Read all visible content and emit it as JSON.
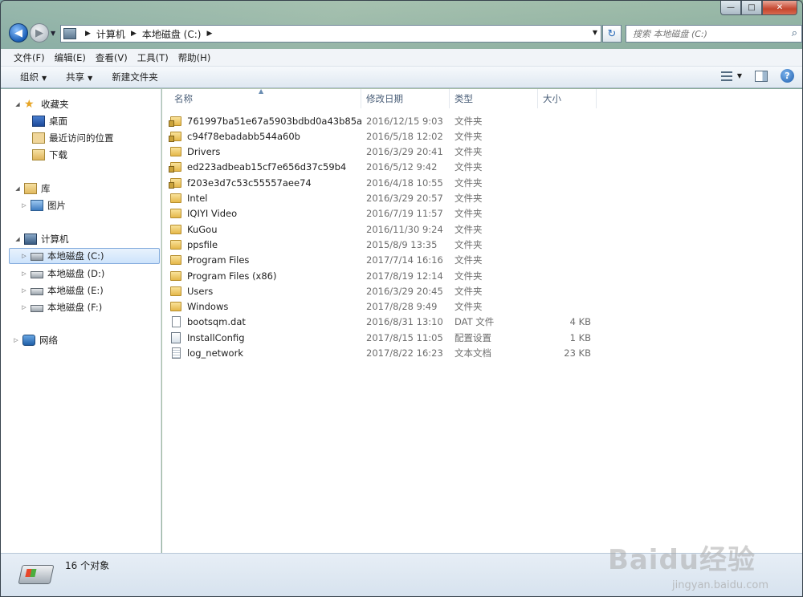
{
  "window": {
    "caption_min": "—",
    "caption_max": "□",
    "caption_close": "✕"
  },
  "address": {
    "crumbs": [
      "计算机",
      "本地磁盘 (C:)"
    ],
    "sep": "▶",
    "search_placeholder": "搜索 本地磁盘 (C:)"
  },
  "menu": [
    "文件(F)",
    "编辑(E)",
    "查看(V)",
    "工具(T)",
    "帮助(H)"
  ],
  "toolbar": {
    "organize": "组织",
    "share": "共享",
    "new_folder": "新建文件夹"
  },
  "nav": {
    "favorites": "收藏夹",
    "desktop": "桌面",
    "recent": "最近访问的位置",
    "downloads": "下载",
    "libraries": "库",
    "pictures": "图片",
    "computer": "计算机",
    "drives": [
      "本地磁盘 (C:)",
      "本地磁盘 (D:)",
      "本地磁盘 (E:)",
      "本地磁盘 (F:)"
    ],
    "network": "网络"
  },
  "columns": {
    "name": "名称",
    "date": "修改日期",
    "type": "类型",
    "size": "大小"
  },
  "files": [
    {
      "name": "761997ba51e67a5903bdbd0a43b85a",
      "date": "2016/12/15 9:03",
      "type": "文件夹",
      "size": "",
      "icon": "folder-locked"
    },
    {
      "name": "c94f78ebadabb544a60b",
      "date": "2016/5/18 12:02",
      "type": "文件夹",
      "size": "",
      "icon": "folder-locked"
    },
    {
      "name": "Drivers",
      "date": "2016/3/29 20:41",
      "type": "文件夹",
      "size": "",
      "icon": "folder"
    },
    {
      "name": "ed223adbeab15cf7e656d37c59b4",
      "date": "2016/5/12 9:42",
      "type": "文件夹",
      "size": "",
      "icon": "folder-locked"
    },
    {
      "name": "f203e3d7c53c55557aee74",
      "date": "2016/4/18 10:55",
      "type": "文件夹",
      "size": "",
      "icon": "folder-locked"
    },
    {
      "name": "Intel",
      "date": "2016/3/29 20:57",
      "type": "文件夹",
      "size": "",
      "icon": "folder"
    },
    {
      "name": "IQIYI Video",
      "date": "2016/7/19 11:57",
      "type": "文件夹",
      "size": "",
      "icon": "folder"
    },
    {
      "name": "KuGou",
      "date": "2016/11/30 9:24",
      "type": "文件夹",
      "size": "",
      "icon": "folder"
    },
    {
      "name": "ppsfile",
      "date": "2015/8/9 13:35",
      "type": "文件夹",
      "size": "",
      "icon": "folder"
    },
    {
      "name": "Program Files",
      "date": "2017/7/14 16:16",
      "type": "文件夹",
      "size": "",
      "icon": "folder"
    },
    {
      "name": "Program Files (x86)",
      "date": "2017/8/19 12:14",
      "type": "文件夹",
      "size": "",
      "icon": "folder"
    },
    {
      "name": "Users",
      "date": "2016/3/29 20:45",
      "type": "文件夹",
      "size": "",
      "icon": "folder"
    },
    {
      "name": "Windows",
      "date": "2017/8/28 9:49",
      "type": "文件夹",
      "size": "",
      "icon": "folder"
    },
    {
      "name": "bootsqm.dat",
      "date": "2016/8/31 13:10",
      "type": "DAT 文件",
      "size": "4 KB",
      "icon": "file"
    },
    {
      "name": "InstallConfig",
      "date": "2017/8/15 11:05",
      "type": "配置设置",
      "size": "1 KB",
      "icon": "config"
    },
    {
      "name": "log_network",
      "date": "2017/8/22 16:23",
      "type": "文本文档",
      "size": "23 KB",
      "icon": "text"
    }
  ],
  "status": {
    "count": "16 个对象"
  },
  "watermark": {
    "main": "Baidu经验",
    "sub": "jingyan.baidu.com"
  }
}
